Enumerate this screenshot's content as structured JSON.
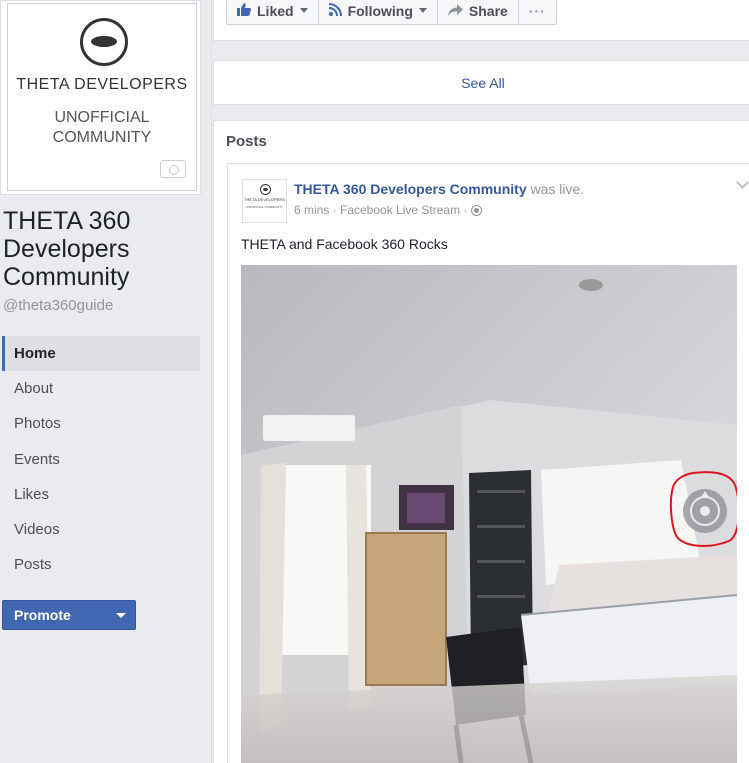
{
  "left": {
    "logo": {
      "title": "THETA DEVELOPERS",
      "subtitle": "UNOFFICIAL COMMUNITY"
    },
    "page_name": "THETA 360 Developers Community",
    "handle": "@theta360guide",
    "nav": [
      "Home",
      "About",
      "Photos",
      "Events",
      "Likes",
      "Videos",
      "Posts"
    ],
    "promote_label": "Promote"
  },
  "actions": {
    "liked": "Liked",
    "following": "Following",
    "share": "Share",
    "more": "···"
  },
  "see_all": "See All",
  "posts": {
    "title": "Posts",
    "post": {
      "author": "THETA 360 Developers Community",
      "status": " was live.",
      "meta": "6 mins · Facebook Live Stream · ",
      "text": "THETA and Facebook 360 Rocks",
      "avatar_title": "THETA DEVELOPERS",
      "avatar_sub": "UNOFFICIAL COMMUNITY"
    }
  },
  "colors": {
    "accent": "#4267b2",
    "link": "#365899",
    "annotation": "#e0141e"
  },
  "icons": [
    "like-icon",
    "rss-icon",
    "share-icon",
    "globe-icon",
    "360-view-icon",
    "camera-icon"
  ]
}
